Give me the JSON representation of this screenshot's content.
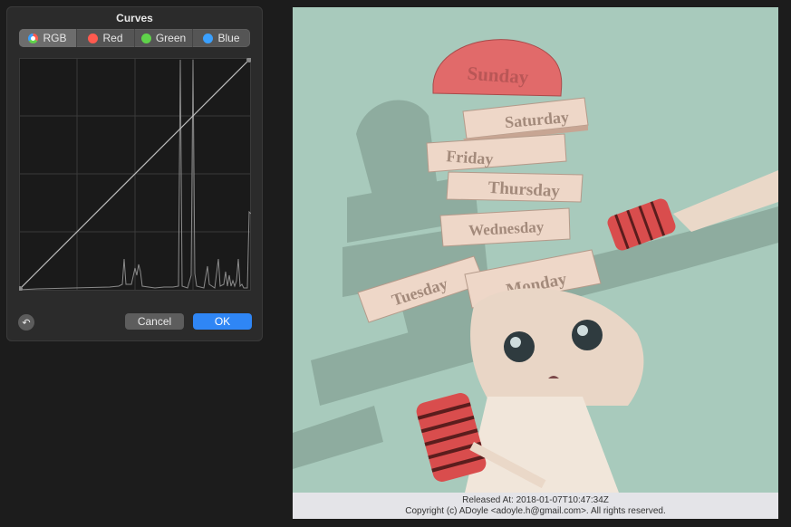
{
  "curves": {
    "title": "Curves",
    "tabs": [
      {
        "label": "RGB",
        "icon": "rgb-color-wheel-icon",
        "color": "#ffffff",
        "active": true
      },
      {
        "label": "Red",
        "icon": "red-dot-icon",
        "color": "#ff5a4f",
        "active": false
      },
      {
        "label": "Green",
        "icon": "green-dot-icon",
        "color": "#5fd34a",
        "active": false
      },
      {
        "label": "Blue",
        "icon": "blue-dot-icon",
        "color": "#3aa0ff",
        "active": false
      }
    ],
    "reset_icon": "undo-arrow-icon",
    "cancel_label": "Cancel",
    "ok_label": "OK",
    "accent": "#2f86f5"
  },
  "image": {
    "labels": [
      "Sunday",
      "Saturday",
      "Friday",
      "Thursday",
      "Wednesday",
      "Tuesday",
      "Monday"
    ],
    "caption_line1": "Released At: 2018-01-07T10:47:34Z",
    "caption_line2": "Copyright (c) ADoyle <adoyle.h@gmail.com>. All rights reserved."
  }
}
